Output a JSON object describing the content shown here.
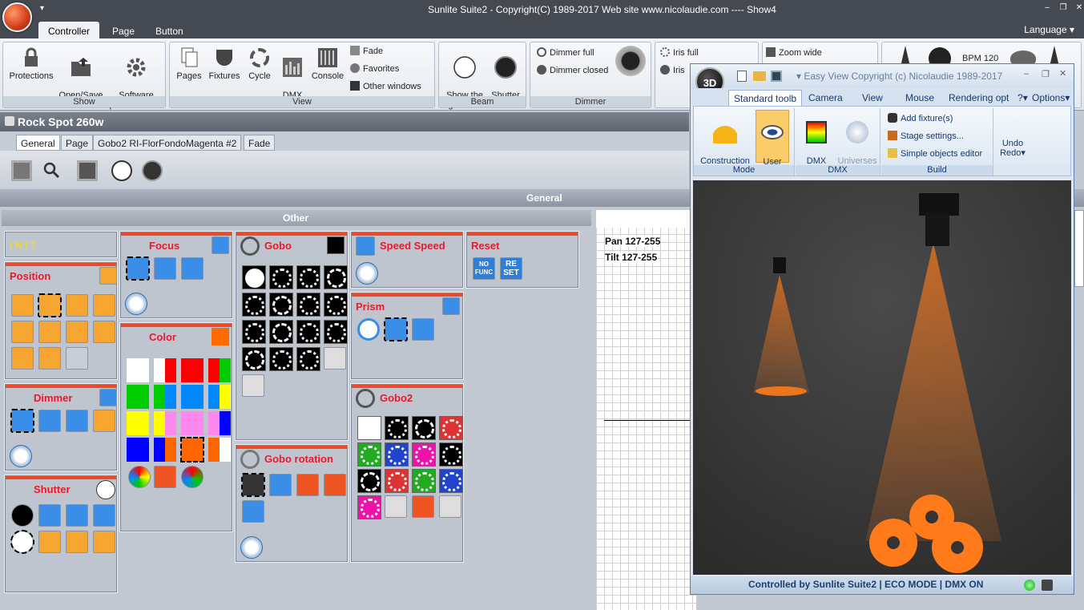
{
  "window": {
    "title": "Sunlite Suite2 - Copyright(C) 1989-2017    Web site www.nicolaudie.com ---- Show4"
  },
  "menu": {
    "tabs": [
      "Controller",
      "Page",
      "Button"
    ],
    "language": "Language"
  },
  "ribbon": {
    "show": {
      "caption": "Show",
      "protections": "Protections",
      "open_save": "Open/Save\nshow",
      "software": "Software\npreferences"
    },
    "view": {
      "caption": "View",
      "pages": "Pages",
      "fixtures": "Fixtures",
      "cycle": "Cycle",
      "dmx": "DMX\nlevel",
      "console": "Console",
      "fade": "Fade",
      "favorites": "Favorites",
      "other": "Other windows"
    },
    "beam": {
      "caption": "Beam",
      "show_light": "Show the\nlight beam",
      "shutter_closed": "Shutter\nclosed"
    },
    "dimmer": {
      "caption": "Dimmer",
      "full": "Dimmer full",
      "closed": "Dimmer closed"
    },
    "iris": {
      "full": "Iris full",
      "iris": "Iris"
    },
    "zoom": {
      "wide": "Zoom wide"
    },
    "bpm": "BPM 120"
  },
  "fixture": {
    "name": "Rock Spot 260w",
    "tabs": [
      "General",
      "Page",
      "Gobo2 RI-FlorFondoMagenta #2",
      "Fade"
    ]
  },
  "general_label": "General",
  "other_label": "Other",
  "panels": {
    "init": "INIT",
    "position": "Position",
    "dimmer": "Dimmer",
    "shutter": "Shutter",
    "focus": "Focus",
    "color": "Color",
    "gobo": "Gobo",
    "gobo_rotation": "Gobo rotation",
    "speed": "Speed Speed",
    "prism": "Prism",
    "gobo2": "Gobo2",
    "reset": "Reset",
    "nofunc": "NO\nFUNC",
    "reset_btn": "RE\nSET"
  },
  "graph": {
    "pan": "Pan 127-255",
    "tilt": "Tilt 127-255"
  },
  "win3d": {
    "title": "Easy View   Copyright (c) Nicolaudie 1989-2017",
    "tabs": [
      "Standard toolb",
      "Camera",
      "View",
      "Mouse",
      "Rendering opt"
    ],
    "help": "?",
    "options": "Options",
    "construction": "Construction\nmode",
    "user": "User\nmode",
    "mode_caption": "Mode",
    "dmx_level": "DMX\nlevel",
    "universes": "Universes\npatch",
    "dmx_caption": "DMX",
    "add_fixture": "Add fixture(s)",
    "stage": "Stage settings...",
    "simple": "Simple objects editor",
    "build_caption": "Build",
    "undo": "Undo\nRedo",
    "status": "Controlled by Sunlite Suite2  |  ECO MODE  |  DMX ON"
  },
  "colors": {
    "accent_red": "#e8192c",
    "panel_bar": "#ec4a2a",
    "beam": "#ff7a1a"
  }
}
